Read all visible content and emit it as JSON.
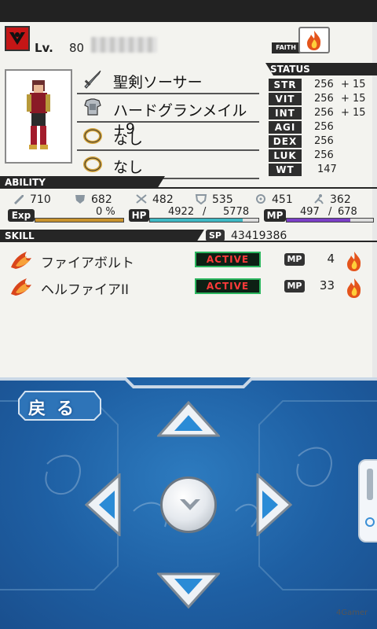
{
  "header": {
    "lv_label": "Lv.",
    "lv_value": "80",
    "faith_label": "FAITH"
  },
  "status": {
    "header": "STATUS",
    "stats": [
      {
        "name": "STR",
        "value": "256",
        "bonus": "+ 15"
      },
      {
        "name": "VIT",
        "value": "256",
        "bonus": "+ 15"
      },
      {
        "name": "INT",
        "value": "256",
        "bonus": "+ 15"
      },
      {
        "name": "AGI",
        "value": "256",
        "bonus": ""
      },
      {
        "name": "DEX",
        "value": "256",
        "bonus": ""
      },
      {
        "name": "LUK",
        "value": "256",
        "bonus": ""
      },
      {
        "name": "WT",
        "value": "147",
        "bonus": ""
      }
    ]
  },
  "equipment": [
    {
      "icon": "sword-icon",
      "label": "聖剣ソーサー"
    },
    {
      "icon": "armor-icon",
      "label": "ハードグランメイル+9"
    },
    {
      "icon": "ring-icon",
      "label": "なし"
    },
    {
      "icon": "ring-icon",
      "label": "なし"
    }
  ],
  "ability": {
    "header": "ABILITY",
    "values": [
      {
        "icon": "attack-icon",
        "value": "710"
      },
      {
        "icon": "defense-icon",
        "value": "682"
      },
      {
        "icon": "magic-attack-icon",
        "value": "482"
      },
      {
        "icon": "magic-defense-icon",
        "value": "535"
      },
      {
        "icon": "accuracy-icon",
        "value": "451"
      },
      {
        "icon": "evasion-icon",
        "value": "362"
      }
    ],
    "exp": {
      "label": "Exp",
      "value": "0 %",
      "ratio": 0.0
    },
    "hp": {
      "label": "HP",
      "current": "4922",
      "sep": "/",
      "max": "5778",
      "ratio": 0.852
    },
    "mp": {
      "label": "MP",
      "current": "497",
      "sep": "/",
      "max": "678",
      "ratio": 0.733
    }
  },
  "skill": {
    "header": "SKILL",
    "sp_label": "SP",
    "sp_value": "43419386",
    "items": [
      {
        "icon": "fire-skill-icon",
        "name": "ファイアボルト",
        "state": "ACTIVE",
        "mp_label": "MP",
        "mp_cost": "4"
      },
      {
        "icon": "fire-skill-icon",
        "name": "ヘルファイアII",
        "state": "ACTIVE",
        "mp_label": "MP",
        "mp_cost": "33"
      }
    ]
  },
  "controls": {
    "back_label": "戻る"
  },
  "colors": {
    "exp_bar": "#c8932e",
    "hp_bar": "#3fb9c4",
    "mp_bar": "#7b3fc7",
    "active_text": "#ff3a3a",
    "active_border": "#2bb55e",
    "pad_blue": "#1e5fa3"
  }
}
